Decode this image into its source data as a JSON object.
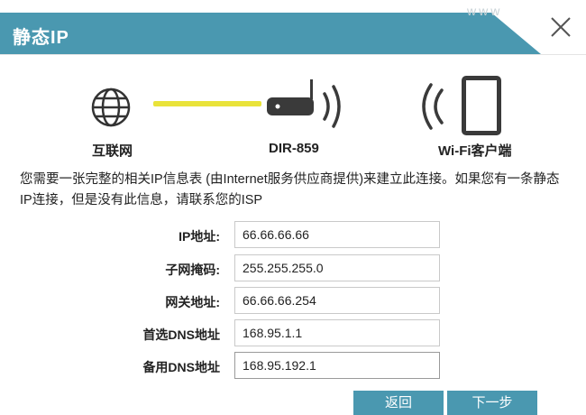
{
  "window": {
    "title": "静态IP",
    "watermark": "www"
  },
  "diagram": {
    "internet_label": "互联网",
    "router_label": "DIR-859",
    "client_label": "Wi-Fi客户端"
  },
  "description": "您需要一张完整的相关IP信息表 (由Internet服务供应商提供)来建立此连接。如果您有一条静态IP连接，但是没有此信息，请联系您的ISP",
  "form": {
    "ip": {
      "label": "IP地址:",
      "value": "66.66.66.66"
    },
    "subnet": {
      "label": "子网掩码:",
      "value": "255.255.255.0"
    },
    "gateway": {
      "label": "网关地址:",
      "value": "66.66.66.254"
    },
    "primary_dns": {
      "label": "首选DNS地址",
      "value": "168.95.1.1"
    },
    "secondary_dns": {
      "label": "备用DNS地址",
      "value": "168.95.192.1"
    }
  },
  "buttons": {
    "back": "返回",
    "next": "下一步"
  },
  "colors": {
    "accent": "#4a98b0",
    "link_line": "#e9e33a"
  },
  "icons": [
    "close-icon",
    "globe-icon",
    "router-icon",
    "wifi-waves-icon",
    "tablet-icon"
  ]
}
